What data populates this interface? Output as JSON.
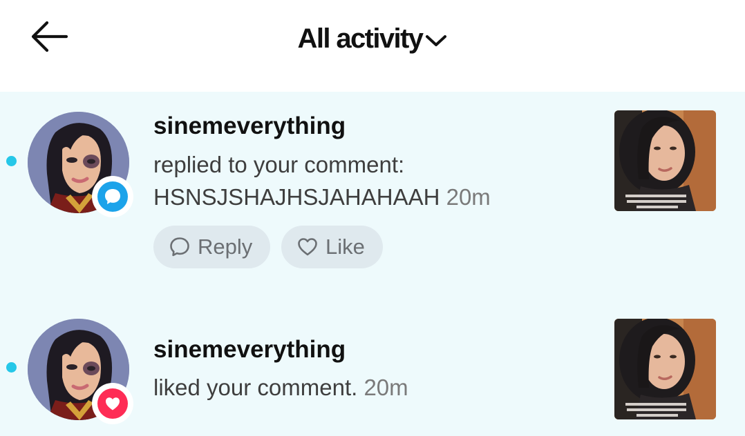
{
  "header": {
    "title": "All activity",
    "back_icon": "arrow-left-icon",
    "dropdown_icon": "chevron-down-icon"
  },
  "colors": {
    "feed_background": "#eefafc",
    "unread_dot": "#25c7e8",
    "comment_badge": "#1ca3ea",
    "like_badge": "#fe2c55",
    "action_pill": "#dfe9ee"
  },
  "notifications": [
    {
      "username": "sinemeverything",
      "action": "replied to your comment:",
      "comment": "HSNSJSHAJHSJAHAHAAH",
      "time": "20m",
      "badge_icon": "comment-bubble-icon",
      "actions": {
        "reply_label": "Reply",
        "like_label": "Like"
      }
    },
    {
      "username": "sinemeverything",
      "action": "liked your comment.",
      "time": "20m",
      "badge_icon": "heart-icon"
    }
  ]
}
